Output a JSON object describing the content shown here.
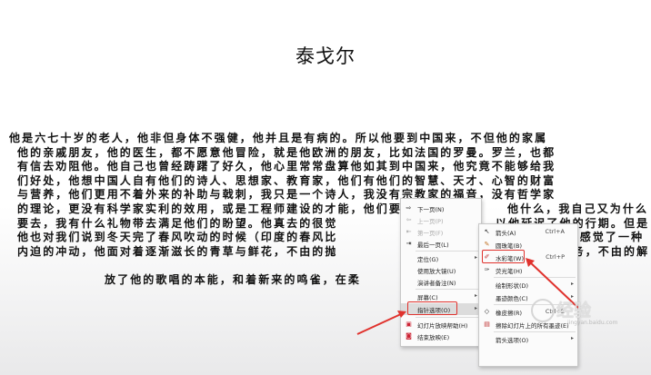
{
  "slide": {
    "title": "泰戈尔",
    "lines": [
      "他是六七十岁的老人，他非但身体不强健，他并且是有病的。所以他要到中国来，不但他的家属",
      "他的亲戚朋友，他的医生，都不愿意他冒险，就是他欧洲的朋友，比如法国的罗曼。罗兰，也都",
      "有信去劝阻他。他自己也曾经踌躇了好久，他心里常常盘算他如其到中国来，他究竟不能够给我",
      "们好处，他想中国人自有他们的诗人、思想家、教育家，他们有他们的智慧、天才、心智的财富",
      "与营养，他们更用不着外来的补助与戟刺，我只是一个诗人，我没有宗教家的福音，没有哲学家",
      "的理论，更没有科学家实利的效用，或是工程师建设的才能，他们要",
      "要去，我有什么礼物带去满足他们的盼望。他真去的很觉",
      "他也对我们说到冬天完了春风吹动的时候（印度的春风比",
      "内迫的冲动，他面对着逐渐滋长的青草与鲜花，不由的抛",
      "放了他的歌唱的本能，和着新来的鸣雀，在柔"
    ],
    "line_tails": [
      "",
      "",
      "",
      "",
      "",
      "他什么，我自己又为什么",
      "以他延迟了他的行期。但是",
      "草），他不由的感觉了一种",
      "了他应尽的职务，不由的解",
      ""
    ]
  },
  "context_menu": {
    "items": [
      {
        "label": "下一页(N)",
        "icon": "next-icon",
        "disabled": false
      },
      {
        "label": "上一页(P)",
        "icon": "prev-icon",
        "disabled": true
      },
      {
        "label": "第一页(F)",
        "icon": "first-icon",
        "disabled": true
      },
      {
        "label": "最后一页(L)",
        "icon": "last-icon",
        "disabled": false
      },
      {
        "label": "定位(G)",
        "icon": "",
        "disabled": false,
        "submenu": true
      },
      {
        "label": "使用放大镜(U)",
        "icon": "",
        "disabled": false
      },
      {
        "label": "演讲者备注(N)",
        "icon": "",
        "disabled": false
      },
      {
        "label": "屏幕(C)",
        "icon": "",
        "disabled": false,
        "submenu": true
      },
      {
        "label": "指针选项(O)",
        "icon": "",
        "disabled": false,
        "submenu": true
      },
      {
        "label": "幻灯片放映帮助(H)",
        "icon": "help-icon",
        "disabled": false
      },
      {
        "label": "结束放映(E)",
        "icon": "end-show-icon",
        "disabled": false
      }
    ]
  },
  "pointer_submenu": {
    "items": [
      {
        "label": "箭头(A)",
        "shortcut": "Ctrl+A",
        "icon": "arrow-pointer-icon"
      },
      {
        "label": "圆珠笔(B)",
        "shortcut": "",
        "icon": "ballpoint-pen-icon"
      },
      {
        "label": "水彩笔(W)",
        "shortcut": "Ctrl+P",
        "icon": "watercolor-pen-icon"
      },
      {
        "label": "荧光笔(H)",
        "shortcut": "",
        "icon": "highlighter-icon"
      },
      {
        "label": "绘制形状(D)",
        "shortcut": "",
        "icon": "",
        "submenu": true
      },
      {
        "label": "墨迹颜色(C)",
        "shortcut": "",
        "icon": "",
        "submenu": true
      },
      {
        "label": "橡皮擦(R)",
        "shortcut": "Ctrl+E",
        "icon": "eraser-icon"
      },
      {
        "label": "擦除幻灯片上的所有墨迹(E)",
        "shortcut": "",
        "icon": "erase-all-icon"
      },
      {
        "label": "箭头选项(O)",
        "shortcut": "",
        "icon": "",
        "submenu": true
      }
    ]
  },
  "watermark": {
    "text": "经验",
    "sub": "jingyan.baidu.com"
  },
  "colors": {
    "accent": "#e0322d",
    "menu_bg": "#fbfbfb",
    "highlight": "#dcdcdc"
  }
}
